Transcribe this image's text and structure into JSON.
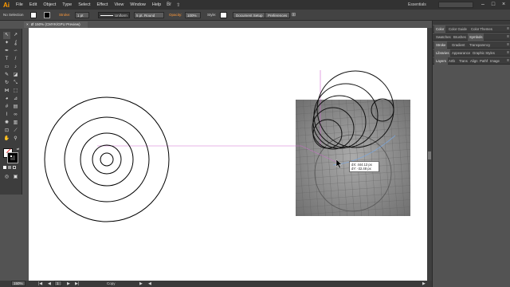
{
  "app": {
    "logo": "Ai"
  },
  "menubar": {
    "items": [
      "File",
      "Edit",
      "Object",
      "Type",
      "Select",
      "Effect",
      "View",
      "Window",
      "Help"
    ],
    "workspace": "Essentials",
    "br_icon": "Br",
    "gpu_icon": "⇧"
  },
  "control": {
    "selection": "No Selection",
    "stroke_label": "Stroke:",
    "stroke_value": "1 pt",
    "profile": "Uniform",
    "brush": "5 pt. Round",
    "opacity_label": "Opacity:",
    "opacity_value": "100%",
    "style_label": "Style:",
    "doc_setup": "Document Setup",
    "preferences": "Preferences",
    "colors": {
      "fill": "#ffffff",
      "stroke": "#000000",
      "accent": "#ff9a3c"
    }
  },
  "document": {
    "tab_title": "Ø 150% (CMYK/GPU Preview)",
    "close_icon": "×"
  },
  "tooltip": {
    "dx": "dX: 444.13 px",
    "dy": "dY: -32.48 px"
  },
  "status": {
    "zoom": "150%",
    "page": "1",
    "mode": "Copy"
  },
  "panels": {
    "group1": [
      "Color",
      "Color Guide",
      "Color Themes"
    ],
    "group2": [
      "Swatches",
      "Brushes",
      "Symbols"
    ],
    "group3": [
      "Stroke",
      "Gradient",
      "Transparency"
    ],
    "group4": [
      "Libraries",
      "Appearance",
      "Graphic Styles"
    ],
    "group5": [
      "Layers",
      "Artb",
      "Trans",
      "Align",
      "Pathf",
      "Image"
    ],
    "menu_icon": "≡"
  }
}
